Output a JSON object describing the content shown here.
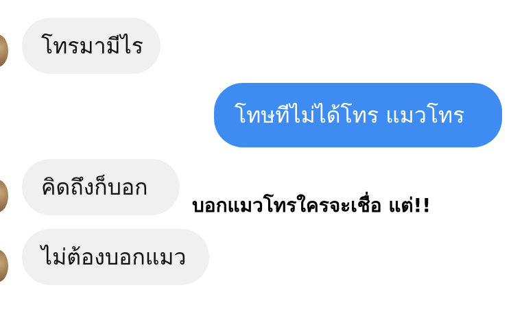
{
  "messages": [
    {
      "direction": "in",
      "text": "โทรมามีไร"
    },
    {
      "direction": "out",
      "text": "โทษทีไม่ได้โทร แมวโทร"
    },
    {
      "direction": "in",
      "text": "คิดถึงก็บอก"
    },
    {
      "direction": "in",
      "text": "ไม่ต้องบอกแมว"
    }
  ],
  "caption": "บอกแมวโทรใครจะเชื่อ แต่!!",
  "colors": {
    "incoming_bubble": "#f0f0f0",
    "outgoing_bubble": "#3e8cf2",
    "incoming_text": "#111111",
    "outgoing_text": "#ffffff",
    "caption_text": "#000000"
  },
  "icons": {
    "avatar": "avatar-photo-icon"
  }
}
